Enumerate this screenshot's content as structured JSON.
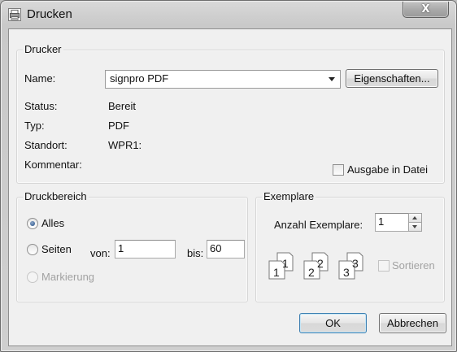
{
  "window": {
    "title": "Drucken",
    "close_glyph": "X"
  },
  "printer": {
    "group_title": "Drucker",
    "name_label": "Name:",
    "name_value": "signpro PDF",
    "properties_button": "Eigenschaften...",
    "status_label": "Status:",
    "status_value": "Bereit",
    "type_label": "Typ:",
    "type_value": "PDF",
    "location_label": "Standort:",
    "location_value": "WPR1:",
    "comment_label": "Kommentar:",
    "comment_value": "",
    "print_to_file_label": "Ausgabe in Datei",
    "print_to_file_checked": false
  },
  "range": {
    "group_title": "Druckbereich",
    "all_label": "Alles",
    "pages_label": "Seiten",
    "from_label": "von:",
    "from_value": "1",
    "to_label": "bis:",
    "to_value": "60",
    "selection_label": "Markierung",
    "selected": "all"
  },
  "copies": {
    "group_title": "Exemplare",
    "count_label": "Anzahl Exemplare:",
    "count_value": "1",
    "collate_label": "Sortieren",
    "collate_checked": false,
    "page_numbers": [
      {
        "back": "1",
        "front": "1"
      },
      {
        "back": "2",
        "front": "2"
      },
      {
        "back": "3",
        "front": "3"
      }
    ]
  },
  "buttons": {
    "ok": "OK",
    "cancel": "Abbrechen"
  },
  "icons": {
    "window": "printer-icon",
    "close": "close-icon"
  }
}
